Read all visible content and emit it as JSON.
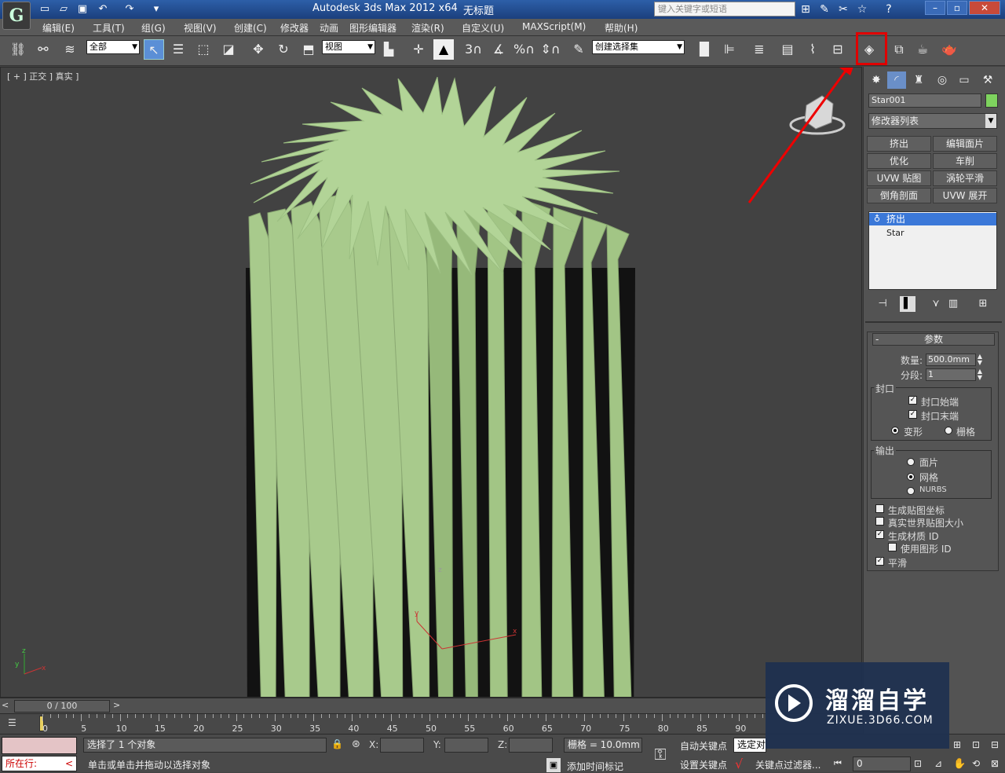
{
  "title_bar": {
    "app_title": "Autodesk 3ds Max  2012 x64",
    "document": "无标题",
    "search_placeholder": "键入关键字或短语"
  },
  "menu": [
    "编辑(E)",
    "工具(T)",
    "组(G)",
    "视图(V)",
    "创建(C)",
    "修改器",
    "动画",
    "图形编辑器",
    "渲染(R)",
    "自定义(U)",
    "MAXScript(M)",
    "帮助(H)"
  ],
  "toolbar": {
    "filter_dropdown": "全部",
    "ref_coord_dropdown": "视图",
    "snap_label": "3",
    "percent_label": "%",
    "selection_set": "创建选择集"
  },
  "viewport": {
    "label": "[ + ] 正交 ] 真实 ]",
    "object_color": "#a6cc8a",
    "axis_z": "z",
    "axis_y": "y",
    "axis_x": "x"
  },
  "command_panel": {
    "object_name": "Star001",
    "object_color": "#7ed35e",
    "modifier_list": "修改器列表",
    "modifier_buttons": [
      "挤出",
      "编辑面片",
      "优化",
      "车削",
      "UVW 贴图",
      "涡轮平滑",
      "倒角剖面",
      "UVW 展开"
    ],
    "stack": [
      "挤出",
      "Star"
    ],
    "rollout_title": "参数",
    "amount_label": "数量:",
    "amount_value": "500.0mm",
    "segments_label": "分段:",
    "segments_value": "1",
    "capping_group": "封口",
    "cap_start": "封口始端",
    "cap_end": "封口末端",
    "morph": "变形",
    "grid": "栅格",
    "output_group": "输出",
    "patch": "面片",
    "mesh": "网格",
    "nurbs": "NURBS",
    "gen_mapping": "生成贴图坐标",
    "real_world": "真实世界贴图大小",
    "gen_mat_ids": "生成材质 ID",
    "use_shape_ids": "使用图形 ID",
    "smooth": "平滑"
  },
  "timeline": {
    "slider_label": "0 / 100",
    "ticks": [
      "0",
      "5",
      "10",
      "15",
      "20",
      "25",
      "30",
      "35",
      "40",
      "45",
      "50",
      "55",
      "60",
      "65",
      "70",
      "75",
      "80",
      "85",
      "90"
    ]
  },
  "status": {
    "selection_info": "选择了 1 个对象",
    "prompt": "单击或单击并拖动以选择对象",
    "running": "所在行:",
    "x_label": "X:",
    "y_label": "Y:",
    "z_label": "Z:",
    "grid": "栅格 = 10.0mm",
    "add_time_tag": "添加时间标记",
    "auto_key": "自动关键点",
    "set_key": "设置关键点",
    "selected": "选定对",
    "key_filters": "关键点过滤器...",
    "frame": "0"
  },
  "watermark": {
    "cn": "溜溜自学",
    "url": "ZIXUE.3D66.COM"
  }
}
